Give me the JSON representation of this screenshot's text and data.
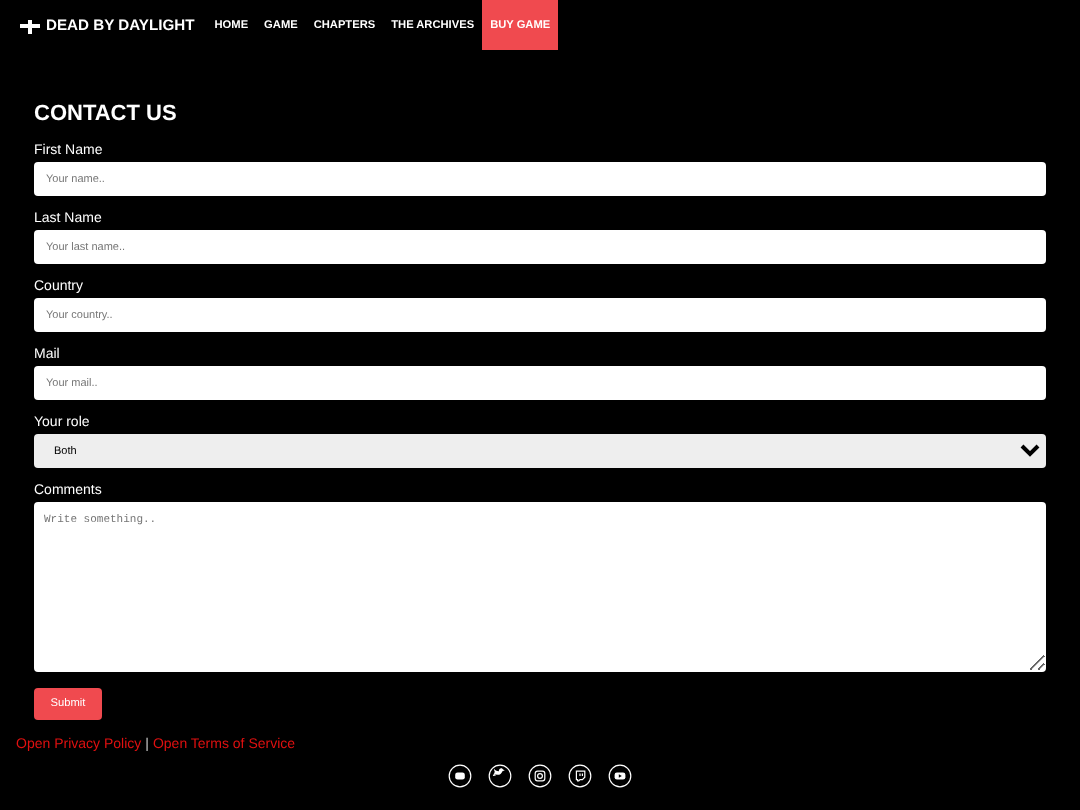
{
  "nav": {
    "logo": "DEAD BY DAYLIGHT",
    "links": [
      {
        "label": "HOME",
        "selected": false
      },
      {
        "label": "GAME",
        "selected": false
      },
      {
        "label": "CHAPTERS",
        "selected": false
      },
      {
        "label": "THE ARCHIVES",
        "selected": false
      },
      {
        "label": "BUY GAME",
        "selected": true
      }
    ]
  },
  "heading": "CONTACT US",
  "fields": [
    {
      "kind": "input",
      "label": "First Name",
      "placeholder": "Your name.."
    },
    {
      "kind": "input",
      "label": "Last Name",
      "placeholder": "Your last name.."
    },
    {
      "kind": "input",
      "label": "Country",
      "placeholder": "Your country.."
    },
    {
      "kind": "input",
      "label": "Mail",
      "placeholder": "Your mail.."
    },
    {
      "kind": "select",
      "label": "Your role",
      "value": "Both"
    },
    {
      "kind": "textarea",
      "label": "Comments",
      "placeholder": "Write something.."
    }
  ],
  "submit": "Submit",
  "footer_links": [
    "Open Privacy Policy",
    "|",
    "Open Terms of Service"
  ]
}
